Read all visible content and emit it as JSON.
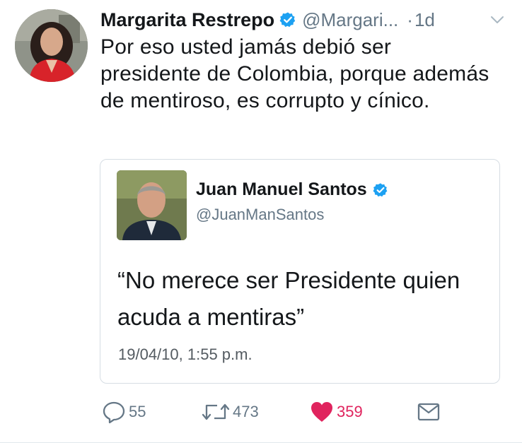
{
  "tweet": {
    "author_name": "Margarita Restrepo",
    "author_handle": "@Margari...",
    "separator": "·",
    "time": "1d",
    "text": "Por eso usted jamás debió ser presidente de Colombia, porque además de mentiroso, es corrupto y cínico."
  },
  "quoted": {
    "author_name": "Juan Manuel Santos",
    "author_handle": "@JuanManSantos",
    "text": "“No merece ser Presidente quien acuda a mentiras”",
    "date": "19/04/10, 1:55 p.m."
  },
  "actions": {
    "reply_count": "55",
    "retweet_count": "473",
    "like_count": "359"
  },
  "colors": {
    "verified": "#1da1f2",
    "like": "#e0245e",
    "secondary_text": "#657786"
  },
  "icons": {
    "verified": "verified-badge-icon",
    "caret": "chevron-down-icon",
    "reply": "reply-icon",
    "retweet": "retweet-icon",
    "like": "heart-icon",
    "dm": "envelope-icon"
  }
}
